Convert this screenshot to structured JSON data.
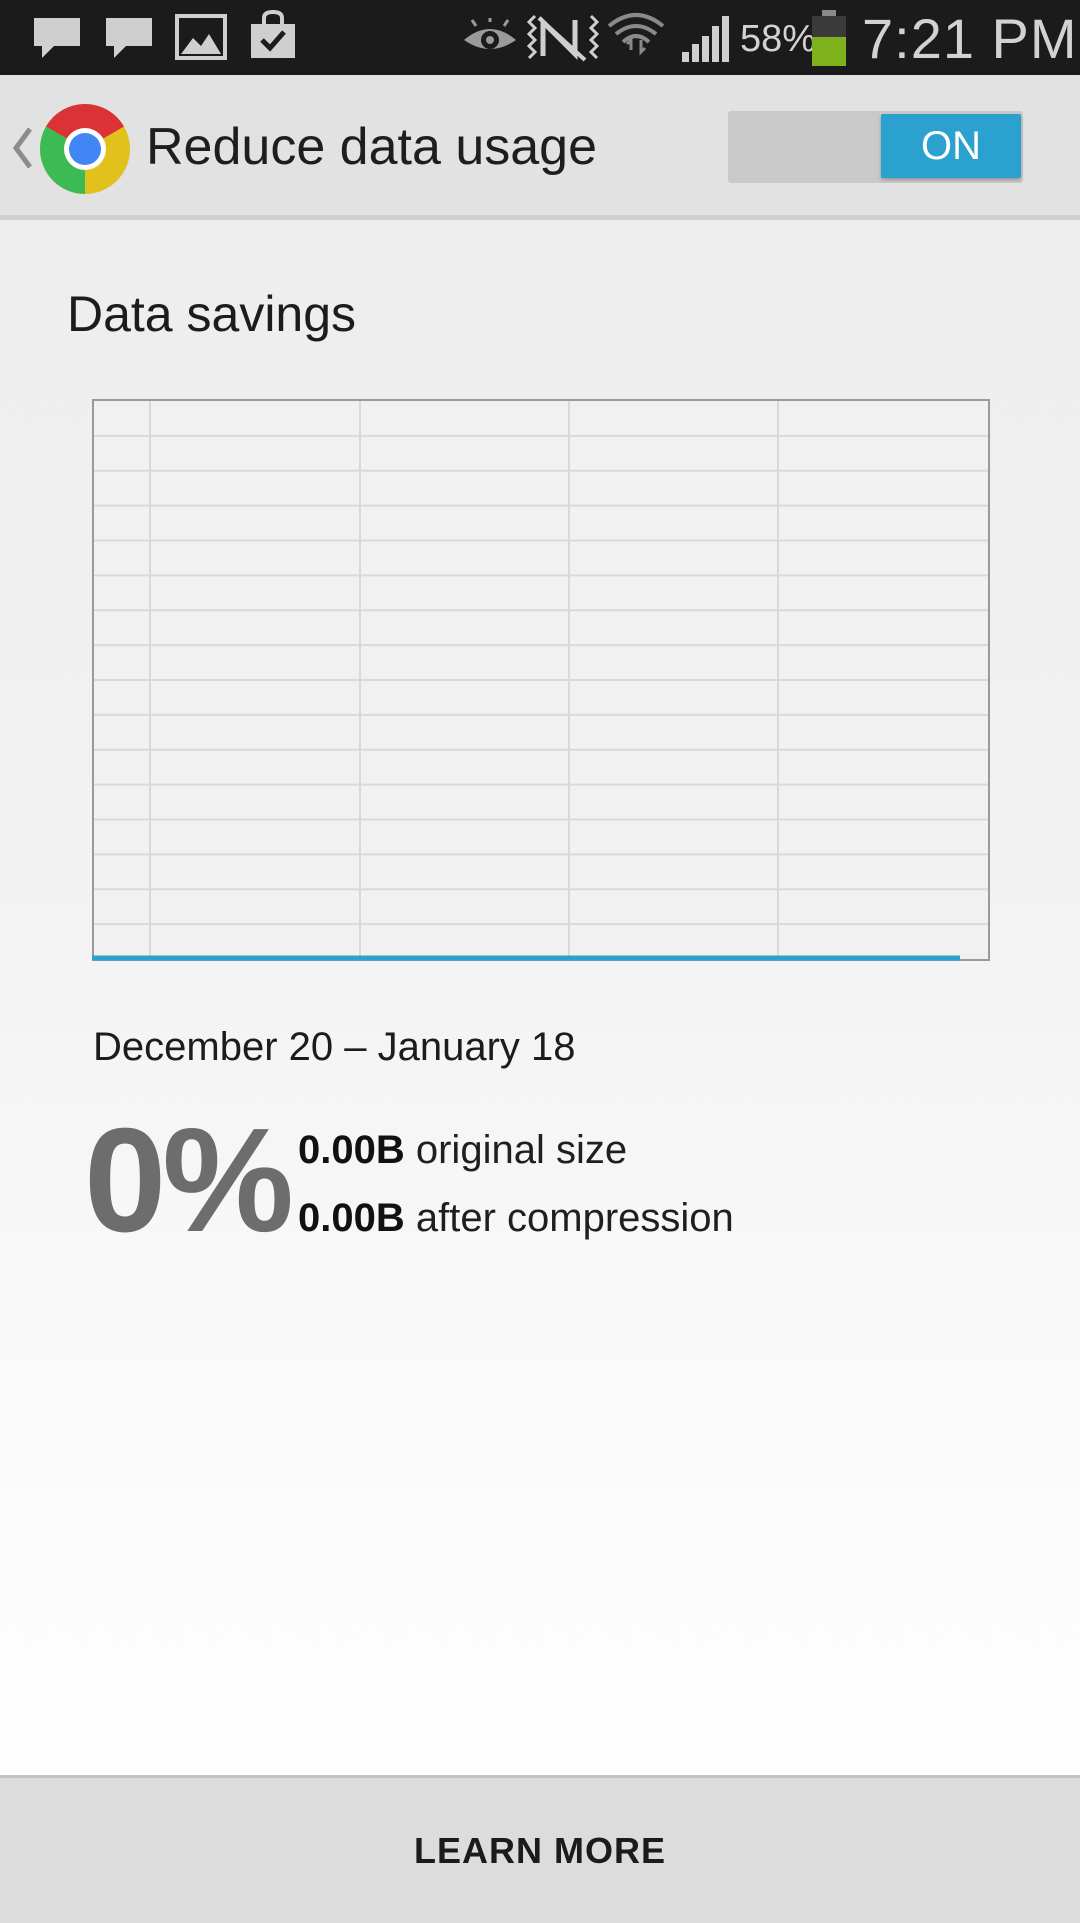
{
  "status_bar": {
    "icons": [
      "message-icon",
      "message-icon",
      "gallery-icon",
      "shopping-bag-icon",
      "smart-stay-eye-icon",
      "nfc-off-icon",
      "wifi-icon",
      "signal-icon",
      "battery-icon"
    ],
    "battery_percent": "58%",
    "battery_level": 0.58,
    "time": "7:21 PM"
  },
  "action_bar": {
    "title": "Reduce data usage",
    "toggle_label": "ON",
    "toggle_on": true,
    "accent_color": "#2aa1cf"
  },
  "content": {
    "section_title": "Data savings",
    "date_range": "December 20 – January 18",
    "savings_percent": "0%",
    "original_size_value": "0.00B",
    "original_size_label": " original size",
    "compressed_size_value": "0.00B",
    "compressed_size_label": " after compression"
  },
  "chart_data": {
    "type": "line",
    "title": "",
    "xlabel": "",
    "ylabel": "",
    "x": [
      0,
      1
    ],
    "series": [
      {
        "values": [
          0,
          0
        ]
      }
    ],
    "ylim": [
      0,
      1
    ],
    "grid": true,
    "line_color": "#2aa1cf"
  },
  "bottom": {
    "learn_more_label": "LEARN MORE"
  }
}
